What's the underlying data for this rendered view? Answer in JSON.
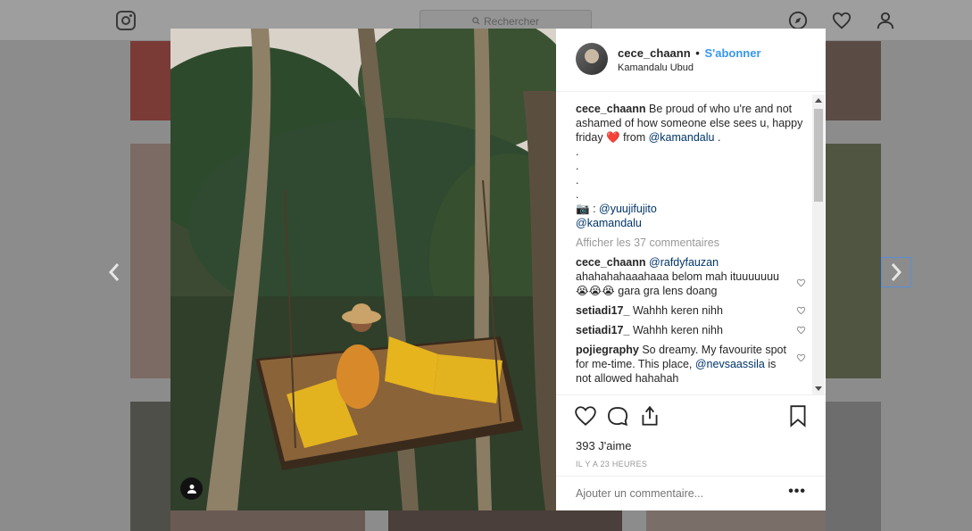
{
  "topbar": {
    "logo": "instagram-icon",
    "search_placeholder": "Rechercher",
    "nav_icons": [
      "compass-icon",
      "heart-icon",
      "profile-icon"
    ]
  },
  "post": {
    "header": {
      "username": "cece_chaann",
      "separator": "•",
      "follow_label": "S'abonner",
      "location": "Kamandalu Ubud"
    },
    "caption": {
      "username": "cece_chaann",
      "line1": "Be proud of who u're and not ashamed of how someone else sees u, happy friday",
      "emoji": "❤️",
      "from_text": "from",
      "mention1": "@kamandalu",
      "trailing": ".",
      "dots": [
        ".",
        ".",
        ".",
        "."
      ],
      "camera": "📷",
      "camera_sep": ":",
      "mention2": "@yuujifujito",
      "mention3": "@kamandalu"
    },
    "view_all_comments": "Afficher les 37 commentaires",
    "comments": [
      {
        "username": "cece_chaann",
        "mention": "@rafdyfauzan",
        "text": "ahahahahaaahaaa belom mah ituuuuuuu 😭😭😭 gara gra lens doang"
      },
      {
        "username": "setiadi17_",
        "mention": "",
        "text": "Wahhh keren nihh"
      },
      {
        "username": "setiadi17_",
        "mention": "",
        "text": "Wahhh keren nihh"
      },
      {
        "username": "pojiegraphy",
        "mention": "",
        "text": "So dreamy. My favourite spot for me-time. This place,",
        "mention_after": "@nevsaassila",
        "text_after": "is not allowed hahahah"
      }
    ],
    "likes": "393 J'aime",
    "timestamp": "IL Y A 23 HEURES",
    "add_comment_placeholder": "Ajouter un commentaire...",
    "more_options": "•••"
  },
  "colors": {
    "link_blue": "#3897f0",
    "mention_blue": "#003569",
    "muted": "#999999"
  }
}
